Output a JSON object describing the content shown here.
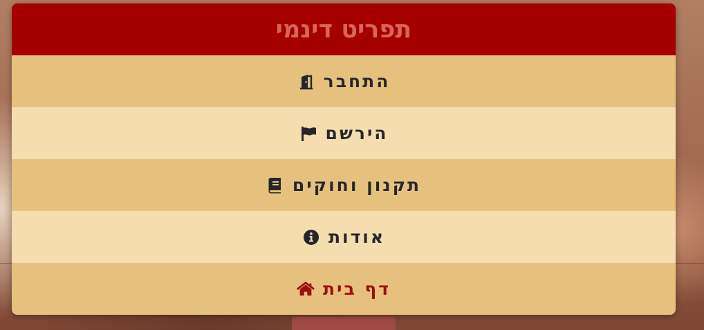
{
  "menu": {
    "title": "תפריט דינמי",
    "items": [
      {
        "label": "התחבר",
        "icon": "door-icon"
      },
      {
        "label": "הירשם",
        "icon": "flag-icon"
      },
      {
        "label": "תקנון וחוקים",
        "icon": "book-icon"
      },
      {
        "label": "אודות",
        "icon": "info-icon"
      },
      {
        "label": "דף בית",
        "icon": "home-icon"
      }
    ]
  },
  "colors": {
    "header": "#a40000",
    "title": "#d8645b",
    "item_dark": "#e6c17e",
    "item_light": "#f5ddb0",
    "text": "#26262a",
    "home_text": "#9b0f0f"
  }
}
